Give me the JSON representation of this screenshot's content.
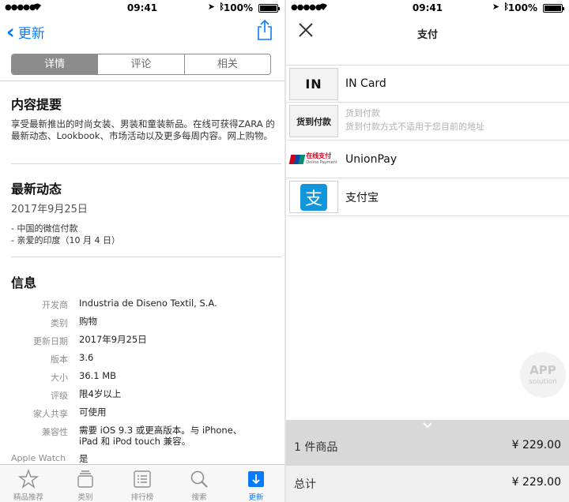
{
  "status_bar": {
    "signal": "●●●●●",
    "time": "09:41",
    "battery": "100%"
  },
  "left": {
    "nav": {
      "back_label": "更新"
    },
    "segments": [
      "详情",
      "评论",
      "相关"
    ],
    "content_summary": {
      "title": "内容提要",
      "text": "享受最新推出的时尚女装、男装和童装新品。在线可获得ZARA 的最新动态、Lookbook、市场活动以及更多每周内容。网上购物。"
    },
    "whats_new": {
      "title": "最新动态",
      "date": "2017年9月25日",
      "notes": [
        "- 中国的微信付款",
        "- 亲爱的印度（10 月 4 日）"
      ]
    },
    "info": {
      "title": "信息",
      "rows": [
        {
          "key": "开发商",
          "value": "Industria de Diseno Textil, S.A."
        },
        {
          "key": "类别",
          "value": "购物"
        },
        {
          "key": "更新日期",
          "value": "2017年9月25日"
        },
        {
          "key": "版本",
          "value": "3.6"
        },
        {
          "key": "大小",
          "value": "36.1 MB"
        },
        {
          "key": "评级",
          "value": "限4岁以上"
        },
        {
          "key": "家人共享",
          "value": "可使用"
        },
        {
          "key": "兼容性",
          "value": "需要 iOS 9.3 或更高版本。与 iPhone、iPad 和 iPod touch 兼容。"
        }
      ],
      "apple_watch_key": "Apple Watch",
      "apple_watch_value": "是"
    },
    "tabbar": [
      {
        "label": "精品推荐",
        "icon": "star-icon"
      },
      {
        "label": "类别",
        "icon": "categories-icon"
      },
      {
        "label": "排行榜",
        "icon": "list-icon"
      },
      {
        "label": "搜索",
        "icon": "search-icon"
      },
      {
        "label": "更新",
        "icon": "updates-icon",
        "active": true
      }
    ]
  },
  "right": {
    "title": "支付",
    "methods": [
      {
        "logo_text": "IN",
        "name": "IN Card"
      },
      {
        "logo_text": "货到付款",
        "name": "货到付款",
        "sub": "货到付款方式不适用于您目前的地址"
      },
      {
        "logo_text": "在线支付",
        "logo_sub": "Online Payment",
        "name": "UnionPay"
      },
      {
        "logo_text": "支",
        "name": "支付宝"
      }
    ],
    "watermark": {
      "line1": "APP",
      "line2": "solution"
    },
    "summary": {
      "items_label": "1 件商品",
      "items_price": "¥ 229.00",
      "total_label": "总计",
      "total_price": "¥ 229.00"
    }
  },
  "colors": {
    "accent": "#0a7bff",
    "alipay": "#1296db",
    "unionpay_red": "#d0021b"
  }
}
